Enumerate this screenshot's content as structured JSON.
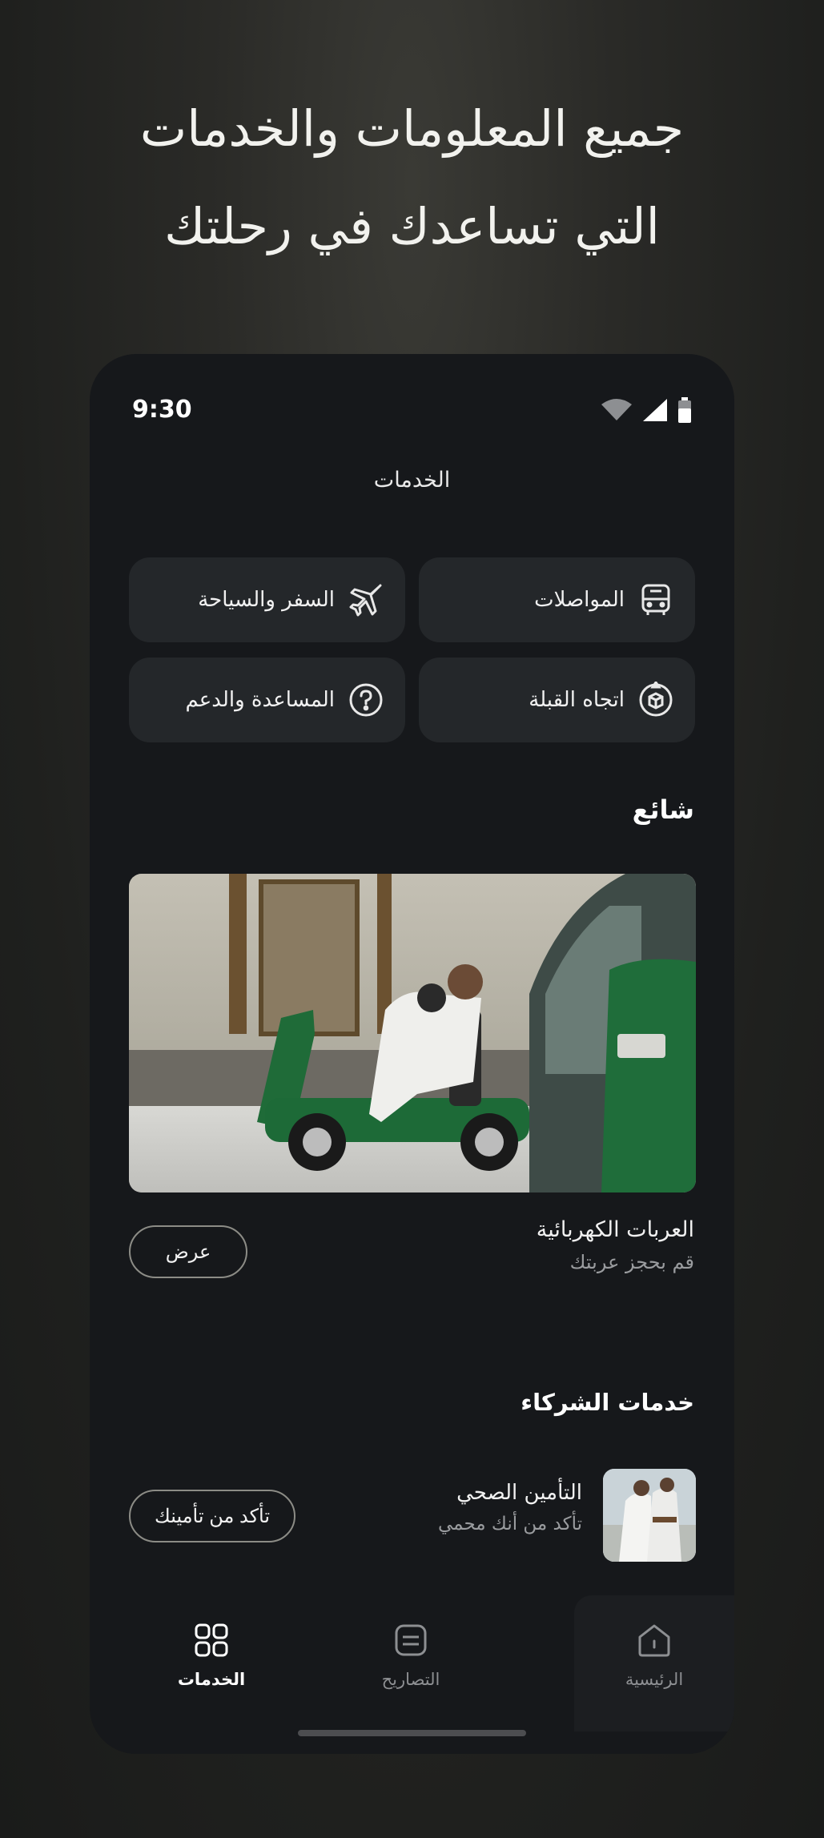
{
  "headline": {
    "line1": "جميع المعلومات والخدمات",
    "line2": "التي تساعدك في رحلتك"
  },
  "status_bar": {
    "time": "9:30",
    "icons": [
      "wifi-icon",
      "signal-icon",
      "battery-icon"
    ]
  },
  "page_title": "الخدمات",
  "service_tiles": [
    {
      "label": "المواصلات",
      "icon": "bus-icon"
    },
    {
      "label": "السفر والسياحة",
      "icon": "airplane-icon"
    },
    {
      "label": "اتجاه القبلة",
      "icon": "qibla-icon"
    },
    {
      "label": "المساعدة والدعم",
      "icon": "help-icon"
    }
  ],
  "popular": {
    "title": "شائع",
    "card": {
      "title": "العربات الكهربائية",
      "subtitle": "قم بحجز عربتك",
      "button": "عرض"
    }
  },
  "partners": {
    "title": "خدمات الشركاء",
    "item": {
      "title": "التأمين الصحي",
      "subtitle": "تأكد من أنك محمي",
      "button": "تأكد من تأمينك"
    }
  },
  "bottom_nav": [
    {
      "label": "الرئيسية",
      "icon": "home-icon",
      "active": false
    },
    {
      "label": "التصاريح",
      "icon": "permits-icon",
      "active": false
    },
    {
      "label": "الخدمات",
      "icon": "grid-icon",
      "active": true
    }
  ],
  "colors": {
    "background": "#16181b",
    "tile": "#24272a",
    "accent_green": "#1e6b3a"
  }
}
